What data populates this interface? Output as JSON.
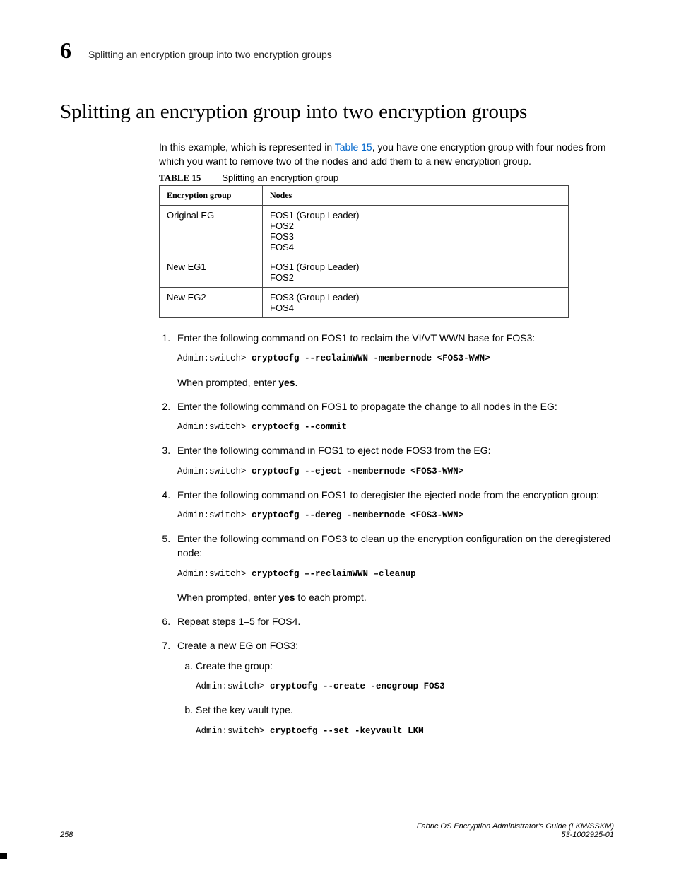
{
  "header": {
    "chapter_number": "6",
    "running_title": "Splitting an encryption group into two encryption groups"
  },
  "title": "Splitting an encryption group into two encryption groups",
  "intro": {
    "part1": "In this example, which is represented in ",
    "xref": "Table 15",
    "part2": ", you have one encryption group with four nodes from which you want to remove two of the nodes and add them to a new encryption group."
  },
  "table": {
    "label": "TABLE 15",
    "caption": "Splitting an encryption group",
    "headers": [
      "Encryption group",
      "Nodes"
    ],
    "rows": [
      {
        "group": "Original EG",
        "nodes": [
          "FOS1 (Group Leader)",
          "FOS2",
          "FOS3",
          "FOS4"
        ]
      },
      {
        "group": "New EG1",
        "nodes": [
          "FOS1 (Group Leader)",
          "FOS2"
        ]
      },
      {
        "group": "New EG2",
        "nodes": [
          "FOS3 (Group Leader)",
          "FOS4"
        ]
      }
    ]
  },
  "steps": {
    "s1": {
      "text": "Enter the following command on FOS1 to reclaim the VI/VT WWN base for FOS3:",
      "prompt": "Admin:switch> ",
      "cmd": "cryptocfg --reclaimWWN -membernode <FOS3-WWN>",
      "note_a": "When prompted, enter ",
      "note_bold": "yes",
      "note_b": "."
    },
    "s2": {
      "text": "Enter the following command on FOS1 to propagate the change to all nodes in the EG:",
      "prompt": "Admin:switch> ",
      "cmd": "cryptocfg --commit"
    },
    "s3": {
      "text": "Enter the following command in FOS1 to eject node FOS3 from the EG:",
      "prompt": "Admin:switch> ",
      "cmd": "cryptocfg --eject -membernode <FOS3-WWN>"
    },
    "s4": {
      "text": "Enter the following command on FOS1 to deregister the ejected node from the encryption group:",
      "prompt": "Admin:switch> ",
      "cmd": "cryptocfg --dereg -membernode <FOS3-WWN>"
    },
    "s5": {
      "text": "Enter the following command on FOS3 to clean up the encryption configuration on the deregistered node:",
      "prompt": "Admin:switch> ",
      "cmd": "cryptocfg –-reclaimWWN –cleanup",
      "note_a": "When prompted, enter ",
      "note_bold": "yes",
      "note_b": " to each prompt."
    },
    "s6": {
      "text": "Repeat steps 1–5 for FOS4."
    },
    "s7": {
      "text": "Create a new EG on FOS3:",
      "a": {
        "text": "Create the group:",
        "prompt": "Admin:switch> ",
        "cmd": "cryptocfg --create -encgroup FOS3"
      },
      "b": {
        "text": "Set the key vault type.",
        "prompt": "Admin:switch> ",
        "cmd": "cryptocfg --set -keyvault LKM"
      }
    }
  },
  "footer": {
    "page": "258",
    "book": "Fabric OS Encryption Administrator's Guide  (LKM/SSKM)",
    "docnum": "53-1002925-01"
  }
}
